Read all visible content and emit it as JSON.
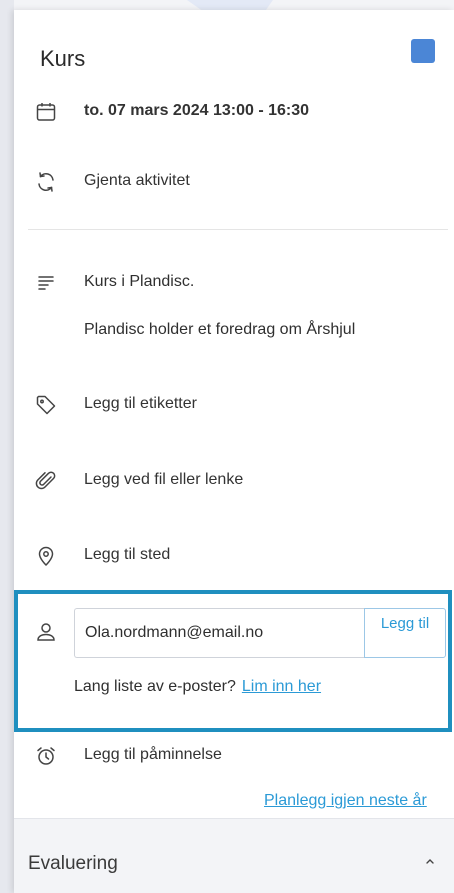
{
  "event": {
    "title": "Kurs",
    "color": "#4b86d6",
    "date_time": "to. 07 mars 2024 13:00 - 16:30",
    "repeat_label": "Gjenta aktivitet"
  },
  "description": {
    "line1": "Kurs i Plandisc.",
    "line2": "Plandisc holder et foredrag om Årshjul"
  },
  "actions": {
    "tags": "Legg til etiketter",
    "attachment": "Legg ved fil eller lenke",
    "location": "Legg til sted",
    "reminder": "Legg til påminnelse"
  },
  "invite": {
    "email_value": "Ola.nordmann@email.no",
    "add_button": "Legg til",
    "paste_prompt": "Lang liste av e-poster?",
    "paste_link": "Lim inn her",
    "highlight_color": "#1f8fbf"
  },
  "plan_next_year": "Planlegg igjen neste år",
  "evaluation": {
    "label": "Evaluering"
  },
  "icons": [
    "calendar-icon",
    "repeat-icon",
    "description-icon",
    "tag-icon",
    "paperclip-icon",
    "location-pin-icon",
    "person-icon",
    "alarm-clock-icon",
    "chevron-up-icon"
  ]
}
